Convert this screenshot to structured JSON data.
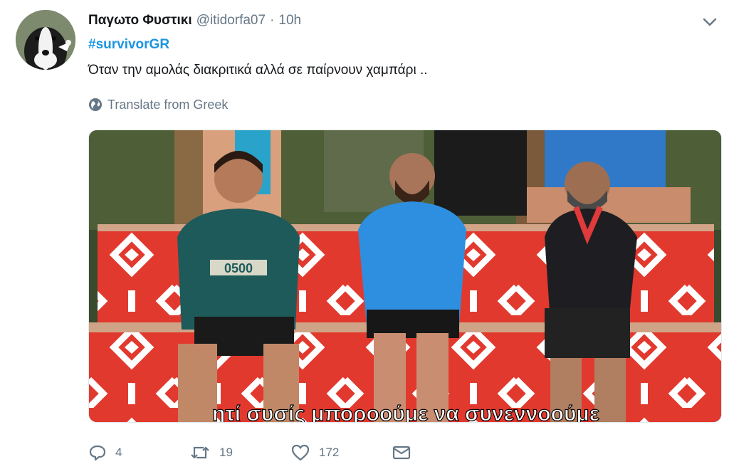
{
  "tweet": {
    "display_name": "Παγωτο Φυστικι",
    "handle": "@itidorfa07",
    "separator": "·",
    "time": "10h",
    "hashtag": "#survivorGR",
    "text": "Όταν την αμολάς διακριτικά αλλά σε παίρνουν χαμπάρι ..",
    "translate_label": "Translate from Greek"
  },
  "media": {
    "subtitle": "ητί συσίς μποροούμε να συνεννοούμε",
    "shirt_print": "0500"
  },
  "actions": {
    "reply_count": "4",
    "retweet_count": "19",
    "like_count": "172"
  },
  "icons": {
    "menu": "chevron-down-icon",
    "translate": "globe-icon",
    "reply": "reply-icon",
    "retweet": "retweet-icon",
    "like": "heart-icon",
    "message": "envelope-icon"
  },
  "colors": {
    "name": "#14171a",
    "secondary": "#657786",
    "link": "#1b95e0"
  }
}
